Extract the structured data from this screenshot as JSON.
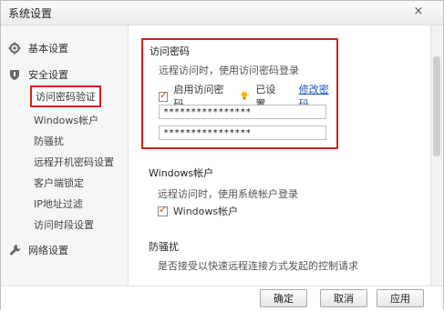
{
  "window": {
    "title": "系统设置",
    "close_glyph": "×"
  },
  "sidebar": {
    "basic": {
      "label": "基本设置",
      "icon": "gear-icon"
    },
    "security": {
      "label": "安全设置",
      "icon": "shield-icon"
    },
    "items": [
      {
        "label": "访问密码验证"
      },
      {
        "label": "Windows帐户"
      },
      {
        "label": "防骚扰"
      },
      {
        "label": "远程开机密码设置"
      },
      {
        "label": "客户端锁定"
      },
      {
        "label": "IP地址过滤"
      },
      {
        "label": "访问时段设置"
      }
    ],
    "network": {
      "label": "网络设置",
      "icon": "wrench-icon"
    }
  },
  "content": {
    "access_password": {
      "title": "访问密码",
      "hint": "远程访问时，使用访问密码登录",
      "enable_label": "启用访问密码",
      "status": "已设置，",
      "modify_link": "修改密码",
      "password_1": "****************",
      "password_2": "****************"
    },
    "windows_account": {
      "title": "Windows帐户",
      "hint": "远程访问时，使用系统帐户登录",
      "checkbox_label": "Windows帐户"
    },
    "anti_harass": {
      "title": "防骚扰",
      "hint": "是否接受以快速远程连接方式发起的控制请求"
    }
  },
  "footer": {
    "ok": "确定",
    "cancel": "取消",
    "apply": "应用"
  },
  "colors": {
    "highlight_border": "#d81e1e",
    "link": "#1d56b3",
    "check": "#cf4b19"
  }
}
